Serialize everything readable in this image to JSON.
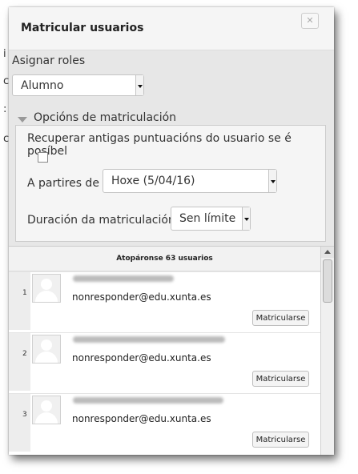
{
  "background": {
    "chars": [
      "i",
      "c",
      ":",
      "c"
    ]
  },
  "dialog": {
    "title": "Matricular usuarios",
    "close_icon": "close-icon"
  },
  "options": {
    "assign_roles_label": "Asignar roles",
    "role_select": {
      "selected": "Alumno"
    },
    "enrol_options_legend": "Opcións de matriculación",
    "recover_grades_label": "Recuperar antigas puntuacións do usuario se é posíbel",
    "recover_grades_checked": false,
    "start_label": "A partires de",
    "start_select": {
      "selected": "Hoxe (5/04/16)"
    },
    "duration_label": "Duración da matriculación",
    "duration_select": {
      "selected": "Sen límite"
    }
  },
  "list": {
    "found_text": "Atopáronse 63 usuarios",
    "users": [
      {
        "index": "1",
        "email": "nonresponder@edu.xunta.es",
        "button": "Matricularse"
      },
      {
        "index": "2",
        "email": "nonresponder@edu.xunta.es",
        "button": "Matricularse"
      },
      {
        "index": "3",
        "email": "nonresponder@edu.xunta.es",
        "button": "Matricularse"
      }
    ]
  }
}
